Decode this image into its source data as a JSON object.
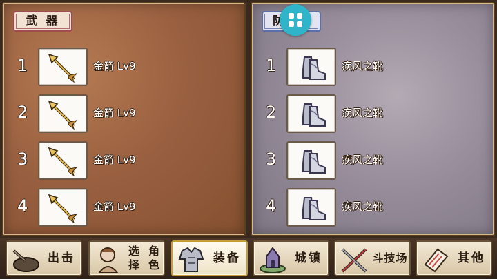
{
  "weapons_panel": {
    "tab_label": "武 器",
    "items": [
      {
        "slot": "1",
        "name": "金箭 Lv9",
        "icon": "golden-arrow-icon"
      },
      {
        "slot": "2",
        "name": "金箭 Lv9",
        "icon": "golden-arrow-icon"
      },
      {
        "slot": "3",
        "name": "金箭 Lv9",
        "icon": "golden-arrow-icon"
      },
      {
        "slot": "4",
        "name": "金箭 Lv9",
        "icon": "golden-arrow-icon"
      }
    ]
  },
  "armor_panel": {
    "tab_label": "防",
    "items": [
      {
        "slot": "1",
        "name": "疾风之靴",
        "icon": "boots-icon"
      },
      {
        "slot": "2",
        "name": "疾风之靴",
        "icon": "boots-icon"
      },
      {
        "slot": "3",
        "name": "疾风之靴",
        "icon": "boots-icon"
      },
      {
        "slot": "4",
        "name": "疾风之靴",
        "icon": "boots-icon"
      }
    ]
  },
  "overlay_button": {
    "icon": "grid-menu-icon",
    "color": "#2fb4c9"
  },
  "bottom_nav": [
    {
      "label": "出击",
      "icon": "sortie-icon",
      "active": false
    },
    {
      "label": "选择角色",
      "line1": "选择",
      "line2": "角色",
      "icon": "character-icon",
      "active": false
    },
    {
      "label": "装备",
      "icon": "armor-icon",
      "active": true
    },
    {
      "label": "城镇",
      "icon": "town-icon",
      "active": false
    },
    {
      "label": "斗技场",
      "icon": "crossed-swords-icon",
      "active": false
    },
    {
      "label": "其他",
      "icon": "scroll-icon",
      "active": false
    }
  ]
}
